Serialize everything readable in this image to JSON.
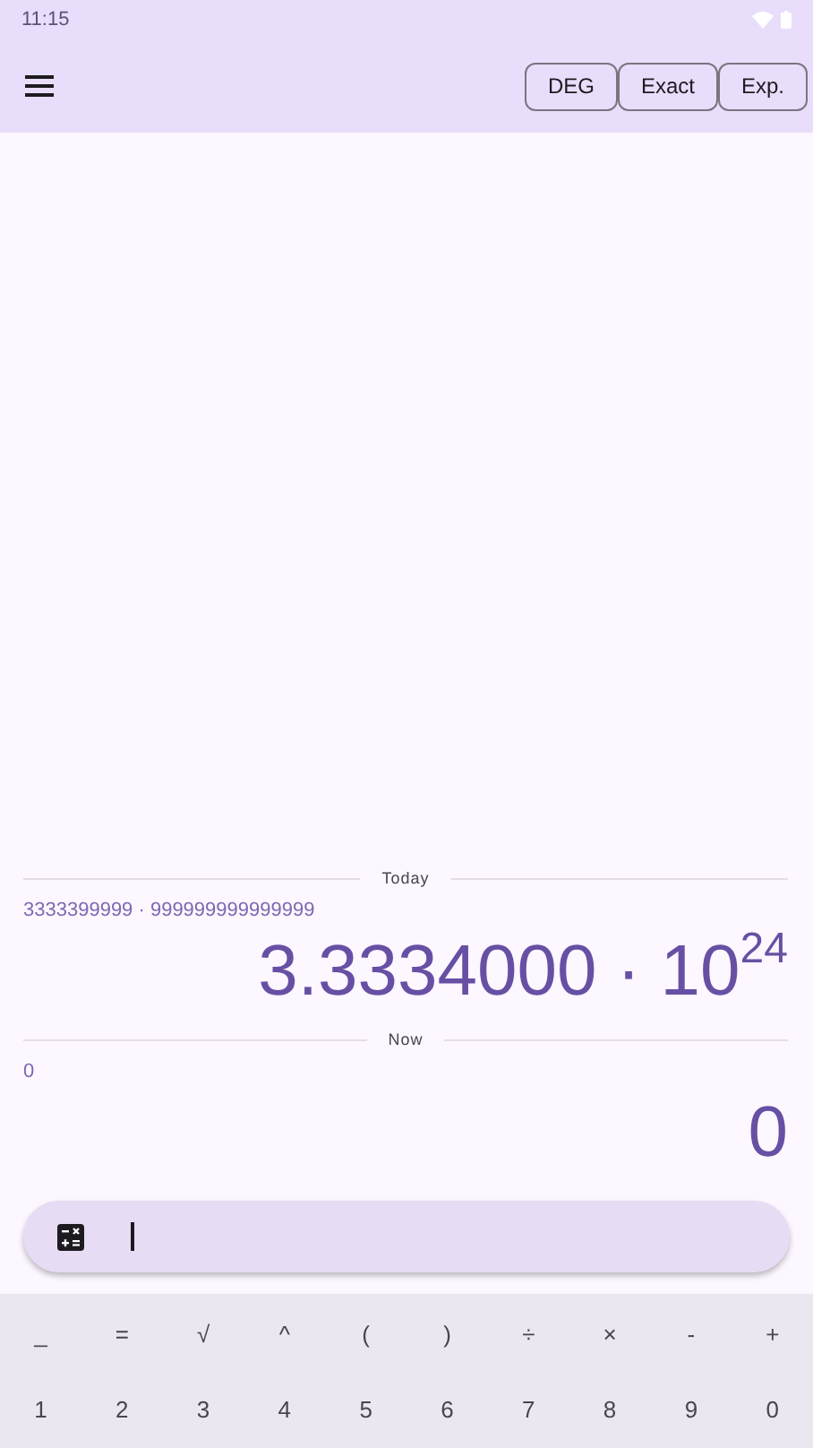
{
  "status_bar": {
    "time": "11:15"
  },
  "toolbar": {
    "buttons": [
      {
        "label": "DEG"
      },
      {
        "label": "Exact"
      },
      {
        "label": "Exp."
      }
    ]
  },
  "history": [
    {
      "label": "Today",
      "expression": "3333399999 · 999999999999999",
      "result": "3.3334000 · 10$^{24}$"
    },
    {
      "label": "Now",
      "expression": "0",
      "result": "0"
    }
  ],
  "keypad": {
    "rows": [
      [
        "_",
        "=",
        "√",
        "^",
        "(",
        ")",
        "÷",
        "×",
        "-",
        "+"
      ],
      [
        "1",
        "2",
        "3",
        "4",
        "5",
        "6",
        "7",
        "8",
        "9",
        "0"
      ]
    ]
  }
}
